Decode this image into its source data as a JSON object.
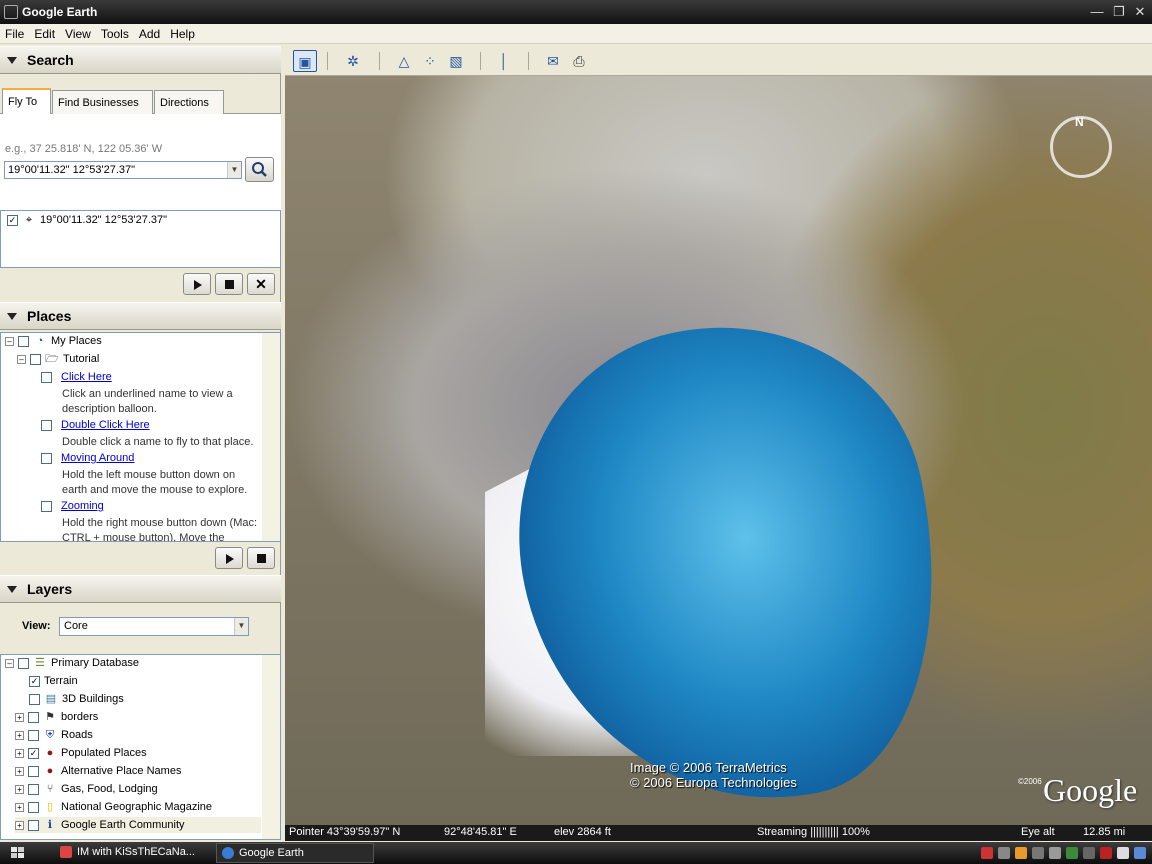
{
  "window": {
    "title": "Google Earth"
  },
  "menu": [
    "File",
    "Edit",
    "View",
    "Tools",
    "Add",
    "Help"
  ],
  "search": {
    "header": "Search",
    "tabs": [
      "Fly To",
      "Find Businesses",
      "Directions"
    ],
    "hint": "e.g., 37 25.818' N, 122 05.36' W",
    "value": "19°00'11.32\" 12°53'27.37\"",
    "result": "19°00'11.32\" 12°53'27.37\""
  },
  "places": {
    "header": "Places",
    "my_places": "My Places",
    "tutorial": "Tutorial",
    "items": [
      {
        "label": "Click Here",
        "desc": "Click an underlined name to view a description balloon."
      },
      {
        "label": "Double Click Here",
        "desc": "Double click a name to fly to that place."
      },
      {
        "label": "Moving Around",
        "desc": "Hold the left mouse button down on earth and move the mouse to explore."
      },
      {
        "label": "Zooming",
        "desc": "Hold the right mouse button down (Mac: CTRL + mouse button). Move the mouse"
      }
    ]
  },
  "layers": {
    "header": "Layers",
    "view_label": "View:",
    "view_value": "Core",
    "items": [
      {
        "label": "Primary Database",
        "checked": false,
        "icon": "database-icon",
        "level": 0
      },
      {
        "label": "Terrain",
        "checked": true,
        "icon": "",
        "level": 1
      },
      {
        "label": "3D Buildings",
        "checked": false,
        "icon": "building-icon",
        "level": 1
      },
      {
        "label": "borders",
        "checked": false,
        "icon": "flag-icon",
        "level": 1
      },
      {
        "label": "Roads",
        "checked": false,
        "icon": "road-shield-icon",
        "level": 1
      },
      {
        "label": "Populated Places",
        "checked": true,
        "icon": "dot-icon",
        "level": 1
      },
      {
        "label": "Alternative Place Names",
        "checked": false,
        "icon": "dot-icon",
        "level": 1
      },
      {
        "label": "Gas, Food, Lodging",
        "checked": false,
        "icon": "fork-knife-icon",
        "level": 1
      },
      {
        "label": "National Geographic Magazine",
        "checked": false,
        "icon": "natgeo-icon",
        "level": 1
      },
      {
        "label": "Google Earth Community",
        "checked": false,
        "icon": "info-icon",
        "level": 1
      }
    ]
  },
  "map": {
    "credit_line1": "Image © 2006 TerraMetrics",
    "credit_line2": "© 2006 Europa Technologies",
    "logo": "Google",
    "logo_year": "©2006"
  },
  "status": {
    "pointer": "Pointer  43°39'59.97\"  N",
    "pointer_e": "92°48'45.81\"   E",
    "elev": "elev  2864 ft",
    "streaming": "Streaming ||||||||||  100%",
    "eye_alt_label": "Eye alt",
    "eye_alt": "12.85 mi"
  },
  "taskbar": {
    "items": [
      "IM with KiSsThECaNa...",
      "Google Earth"
    ]
  },
  "colors": {
    "water": "#1e87c4",
    "title_bar": "#111111",
    "link": "#0000cc"
  }
}
